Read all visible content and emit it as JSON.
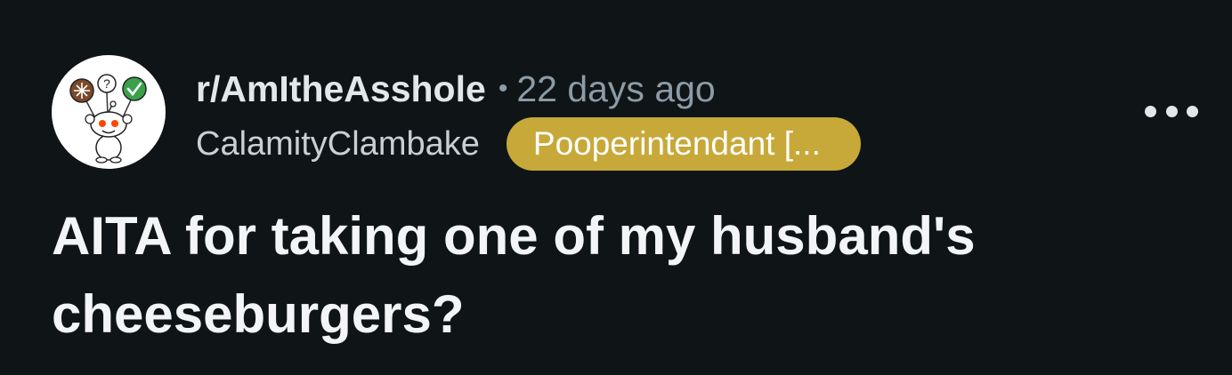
{
  "post": {
    "subreddit": "r/AmItheAsshole",
    "separator": "•",
    "time_ago": "22 days ago",
    "author": "CalamityClambake",
    "flair": "Pooperintendant [...",
    "title": "AITA for taking one of my husband's cheeseburgers?"
  },
  "icons": {
    "avatar": "subreddit-avatar-icon",
    "more": "more-options-icon"
  },
  "colors": {
    "background": "#0f1416",
    "flair_background": "#c7a93a",
    "meta_muted": "#8c9ba6",
    "title_text": "#f2f4f5"
  }
}
